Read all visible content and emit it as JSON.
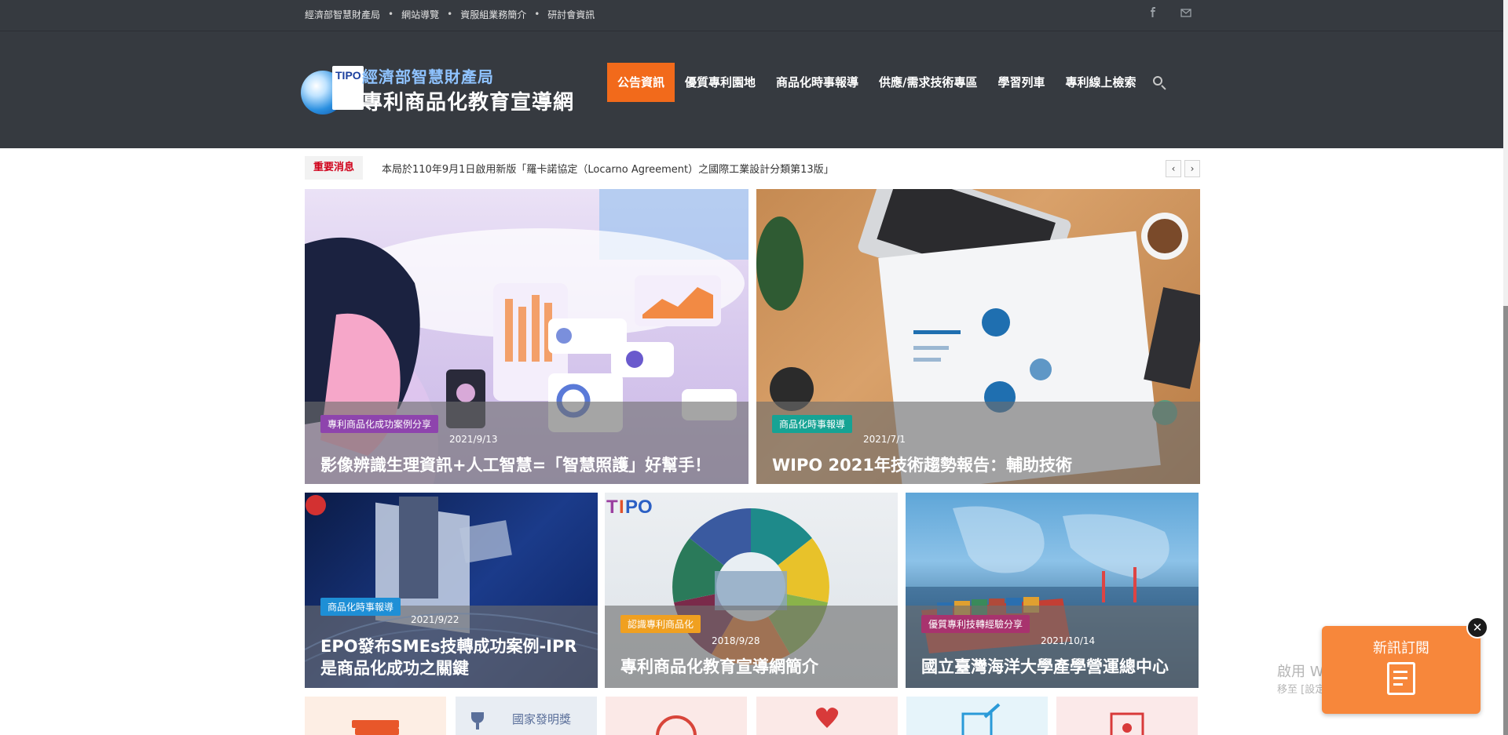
{
  "topbar": {
    "links": [
      "經濟部智慧財產局",
      "網站導覽",
      "資服組業務簡介",
      "研討會資訊"
    ],
    "social": [
      "facebook-icon",
      "mail-icon"
    ]
  },
  "logo": {
    "line1": "經濟部智慧財產局",
    "line2": "專利商品化教育宣導網",
    "badge": "TIPO"
  },
  "nav": {
    "items": [
      "公告資訊",
      "優質專利園地",
      "商品化時事報導",
      "供應/需求技術專區",
      "學習列車",
      "專利線上檢索"
    ],
    "active": "公告資訊"
  },
  "ticker": {
    "tag": "重要消息",
    "text": "本局於110年9月1日啟用新版「羅卡諾協定（Locarno Agreement）之國際工業設計分類第13版」",
    "prev": "‹",
    "next": "›"
  },
  "cards": [
    {
      "category": "專利商品化成功案例分享",
      "category_color": "#8e44ad",
      "date": "2021/9/13",
      "title": "影像辨識生理資訊+人工智慧=「智慧照護」好幫手！"
    },
    {
      "category": "商品化時事報導",
      "category_color": "#16a394",
      "date": "2021/7/1",
      "title": "WIPO 2021年技術趨勢報告：輔助技術"
    },
    {
      "category": "商品化時事報導",
      "category_color": "#1e8fd6",
      "date": "2021/9/22",
      "title": "EPO發布SMEs技轉成功案例-IPR是商品化成功之關鍵"
    },
    {
      "category": "認識專利商品化",
      "category_color": "#f0a020",
      "date": "2018/9/28",
      "title": "專利商品化教育宣導網簡介"
    },
    {
      "category": "優質專利技轉經驗分享",
      "category_color": "#a8336e",
      "date": "2021/10/14",
      "title": "國立臺灣海洋大學產學營運總中心"
    }
  ],
  "tiles": [
    {
      "bg": "#fdeee4",
      "icon": "books-icon"
    },
    {
      "bg": "#e8edf3",
      "icon": "trophy-icon",
      "label": "國家發明獎"
    },
    {
      "bg": "#fbe9e7",
      "icon": "globe-icon"
    },
    {
      "bg": "#fbe9e7",
      "icon": "heart-hands-icon"
    },
    {
      "bg": "#e6f4fa",
      "icon": "edit-doc-icon"
    },
    {
      "bg": "#fbe9e9",
      "icon": "id-card-icon"
    }
  ],
  "subscribe": {
    "label": "新訊訂閱",
    "close": "✕"
  },
  "watermark": {
    "line1": "啟用 Windows",
    "line2": "移至 [設定] 以啟用 Windows。"
  }
}
